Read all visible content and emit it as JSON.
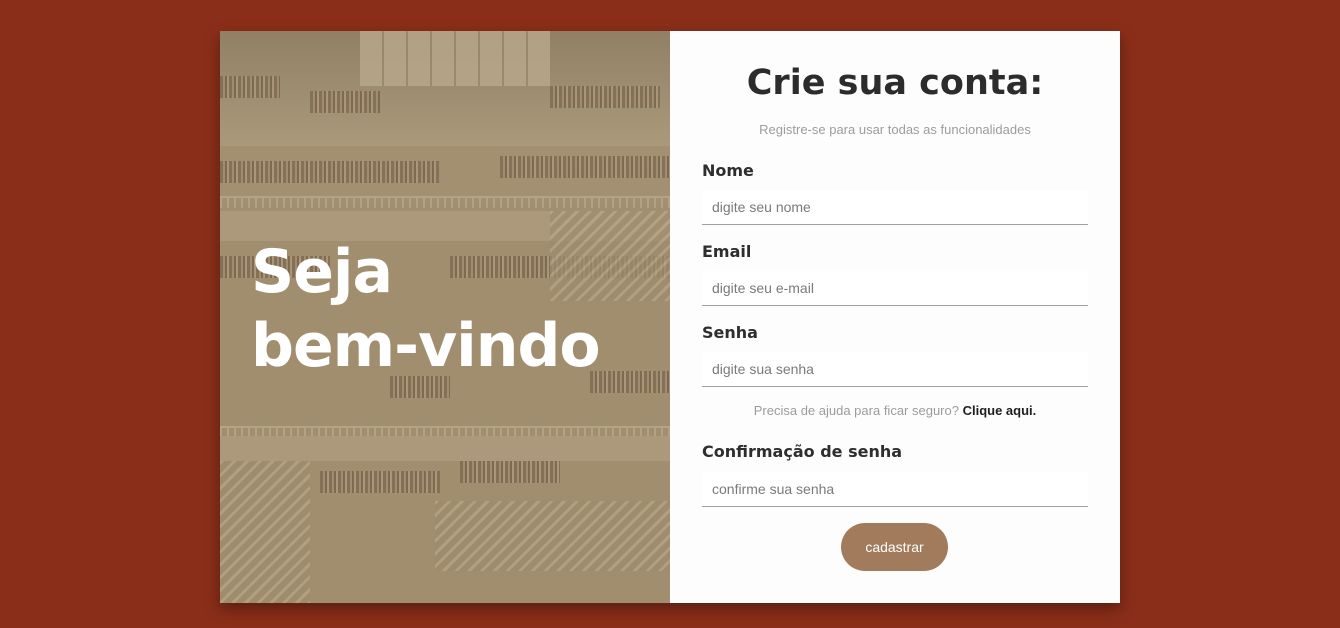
{
  "hero": {
    "heading_line1": "Seja",
    "heading_line2": "bem-vindo",
    "image": "library-interior-photo"
  },
  "form": {
    "title": "Crie sua conta:",
    "subtitle": "Registre-se para usar todas as funcionalidades",
    "fields": [
      {
        "label": "Nome",
        "placeholder": "digite seu nome",
        "value": ""
      },
      {
        "label": "Email",
        "placeholder": "digite seu e-mail",
        "value": ""
      },
      {
        "label": "Senha",
        "placeholder": "digite sua senha",
        "value": ""
      },
      {
        "label": "Confirmação de senha",
        "placeholder": "confirme sua senha",
        "value": ""
      }
    ],
    "help_text": "Precisa de ajuda para ficar seguro?",
    "help_link": "Clique aqui.",
    "submit_label": "cadastrar"
  },
  "colors": {
    "page_background": "#8a2e19",
    "button": "#a17b5b",
    "card_background": "#fdfdfd"
  }
}
